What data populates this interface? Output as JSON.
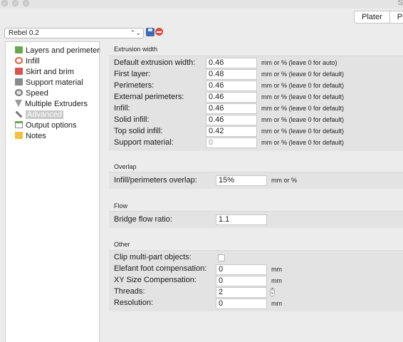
{
  "window": {
    "title_fragment": "S"
  },
  "tabs": [
    {
      "label": "Plater"
    },
    {
      "label": "Print"
    }
  ],
  "preset": {
    "value": "Rebel 0.2"
  },
  "sidebar": {
    "items": [
      {
        "label": "Layers and perimeters",
        "icon": "layers-icon"
      },
      {
        "label": "Infill",
        "icon": "infill-icon"
      },
      {
        "label": "Skirt and brim",
        "icon": "skirt-icon"
      },
      {
        "label": "Support material",
        "icon": "support-icon"
      },
      {
        "label": "Speed",
        "icon": "speed-icon"
      },
      {
        "label": "Multiple Extruders",
        "icon": "funnel-icon"
      },
      {
        "label": "Advanced",
        "icon": "wrench-icon",
        "selected": true
      },
      {
        "label": "Output options",
        "icon": "page-icon"
      },
      {
        "label": "Notes",
        "icon": "note-icon"
      }
    ]
  },
  "extrusion_width": {
    "title": "Extrusion width",
    "rows": [
      {
        "label": "Default extrusion width:",
        "value": "0.46",
        "unit": "mm or % (leave 0 for auto)"
      },
      {
        "label": "First layer:",
        "value": "0.48",
        "unit": "mm or % (leave 0 for default)"
      },
      {
        "label": "Perimeters:",
        "value": "0.46",
        "unit": "mm or % (leave 0 for default)"
      },
      {
        "label": "External perimeters:",
        "value": "0.46",
        "unit": "mm or % (leave 0 for default)"
      },
      {
        "label": "Infill:",
        "value": "0.46",
        "unit": "mm or % (leave 0 for default)"
      },
      {
        "label": "Solid infill:",
        "value": "0.46",
        "unit": "mm or % (leave 0 for default)"
      },
      {
        "label": "Top solid infill:",
        "value": "0.42",
        "unit": "mm or % (leave 0 for default)"
      },
      {
        "label": "Support material:",
        "value": "0",
        "unit": "mm or % (leave 0 for default)",
        "disabled": true
      }
    ]
  },
  "overlap": {
    "title": "Overlap",
    "rows": [
      {
        "label": "Infill/perimeters overlap:",
        "value": "15%",
        "unit": "mm or %"
      }
    ]
  },
  "flow": {
    "title": "Flow",
    "rows": [
      {
        "label": "Bridge flow ratio:",
        "value": "1.1"
      }
    ]
  },
  "other": {
    "title": "Other",
    "clip": {
      "label": "Clip multi-part objects:",
      "checked": false
    },
    "elefant": {
      "label": "Elefant foot compensation:",
      "value": "0",
      "unit": "mm"
    },
    "xy": {
      "label": "XY Size Compensation:",
      "value": "0",
      "unit": "mm"
    },
    "threads": {
      "label": "Threads:",
      "value": "2"
    },
    "resolution": {
      "label": "Resolution:",
      "value": "0",
      "unit": "mm"
    }
  }
}
